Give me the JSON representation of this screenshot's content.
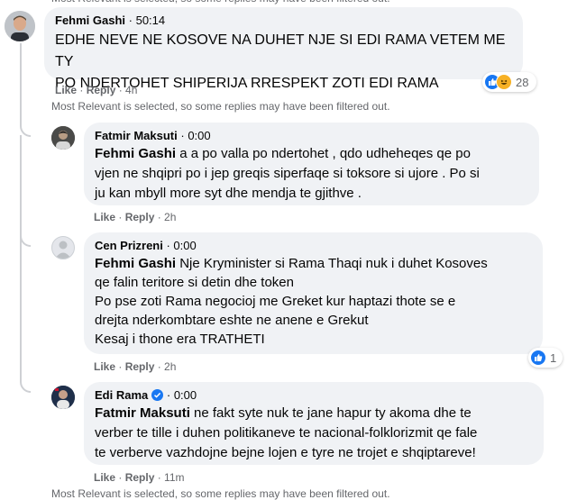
{
  "filter_notice": "Most Relevant is selected, so some replies may have been filtered out.",
  "comments": [
    {
      "author": "Fehmi Gashi",
      "separator": " · ",
      "timestamp": "50:14",
      "line1": "EDHE NEVE NE KOSOVE NA DUHET NJE SI EDI RAMA VETEM ME TY",
      "line2": "PO NDERTOHET SHIPERIJA RRESPEKT ZOTI EDI RAMA",
      "like": "Like",
      "reply": "Reply",
      "age": "4h",
      "reaction_count": "28"
    },
    {
      "author": "Fatmir Maksuti",
      "separator": " · ",
      "timestamp": "0:00",
      "mention": "Fehmi Gashi",
      "line1": " a a po valla po ndertohet , qdo udheheqes qe po",
      "line2": "vjen ne shqipri po i jep greqis siperfaqe si toksore si ujore . Po si",
      "line3": "ju kan mbyll more syt dhe mendja te gjithve .",
      "like": "Like",
      "reply": "Reply",
      "age": "2h"
    },
    {
      "author": "Cen Prizreni",
      "separator": " · ",
      "timestamp": "0:00",
      "mention": "Fehmi Gashi",
      "line1": " Nje Kryminister si Rama Thaqi nuk i duhet Kosoves",
      "line2": "qe falin teritore si detin dhe token",
      "line3": "Po pse zoti Rama negocioj me Greket kur haptazi thote se e",
      "line4": "drejta nderkombtare eshte ne anene e Grekut",
      "line5": "Kesaj i thone era TRATHETI",
      "like": "Like",
      "reply": "Reply",
      "age": "2h",
      "reaction_count": "1"
    },
    {
      "author": "Edi Rama",
      "separator": " · ",
      "timestamp": "0:00",
      "mention": "Fatmir Maksuti",
      "line1": " ne fakt syte nuk te jane hapur ty akoma dhe te",
      "line2": "verber te tille i duhen politikaneve te nacional-folklorizmit qe fale",
      "line3": "te verberve vazhdojne bejne lojen e tyre ne trojet e shqiptareve!",
      "like": "Like",
      "reply": "Reply",
      "age": "11m"
    }
  ],
  "icons": {
    "like_reaction": "thumbs-up-icon",
    "haha_reaction": "laughing-face-icon",
    "verified": "verified-badge-icon"
  },
  "colors": {
    "bubble": "#f0f2f5",
    "meta_text": "#65676b",
    "like_blue": "#1877f2",
    "haha_yellow": "#f7b125"
  }
}
